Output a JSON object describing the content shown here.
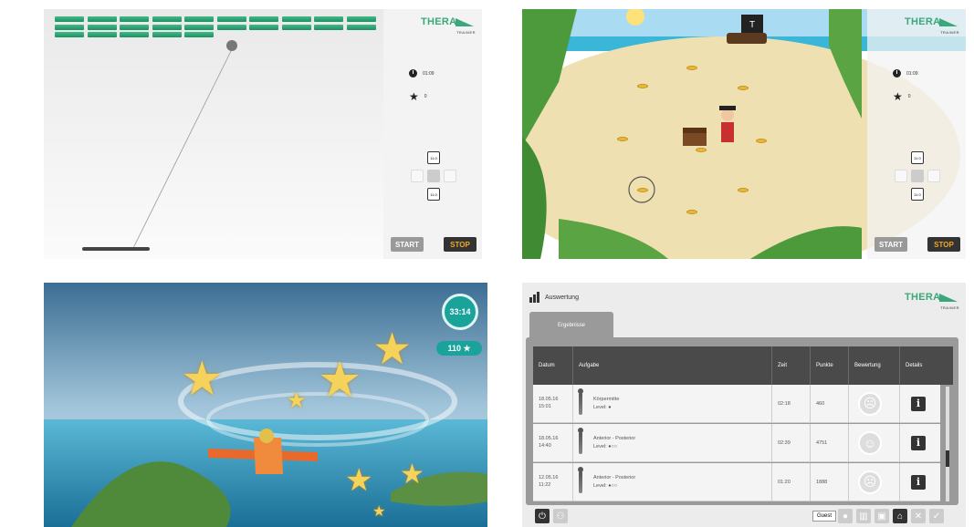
{
  "brand": {
    "name": "THERA",
    "sub": "TRAINER",
    "color": "#3aa87b"
  },
  "breakout": {
    "time": "01:09",
    "stars": "0",
    "dpad_top": "11.0",
    "dpad_bottom": "11.0",
    "start_label": "START",
    "stop_label": "STOP",
    "icons": {
      "time": "clock-icon",
      "score": "star-icon"
    }
  },
  "pirate": {
    "time": "01:09",
    "stars": "0",
    "dpad_top": "11.0",
    "dpad_bottom": "11.0",
    "start_label": "START",
    "stop_label": "STOP"
  },
  "flight": {
    "timer": "33:14",
    "score": "110 ★"
  },
  "results": {
    "title": "Auswertung",
    "tab": "Ergebnisse",
    "columns": [
      "Datum",
      "Aufgabe",
      "Zeit",
      "Punkte",
      "Bewertung",
      "Details"
    ],
    "rows": [
      {
        "date": "18.05.16\n15:01",
        "task": "Körpermitte",
        "level": "Level: ●",
        "time": "02:18",
        "points": "460",
        "rating": "neutral",
        "details": "i"
      },
      {
        "date": "18.05.16\n14:40",
        "task": "Anterior - Posterior",
        "level": "Level: ●○○",
        "time": "02:39",
        "points": "4751",
        "rating": "happy",
        "details": "i"
      },
      {
        "date": "12.05.16\n11:22",
        "task": "Anterior - Posterior",
        "level": "Level: ●○○",
        "time": "01:20",
        "points": "1888",
        "rating": "sad",
        "details": "i"
      }
    ],
    "footer_user": "Guest"
  }
}
